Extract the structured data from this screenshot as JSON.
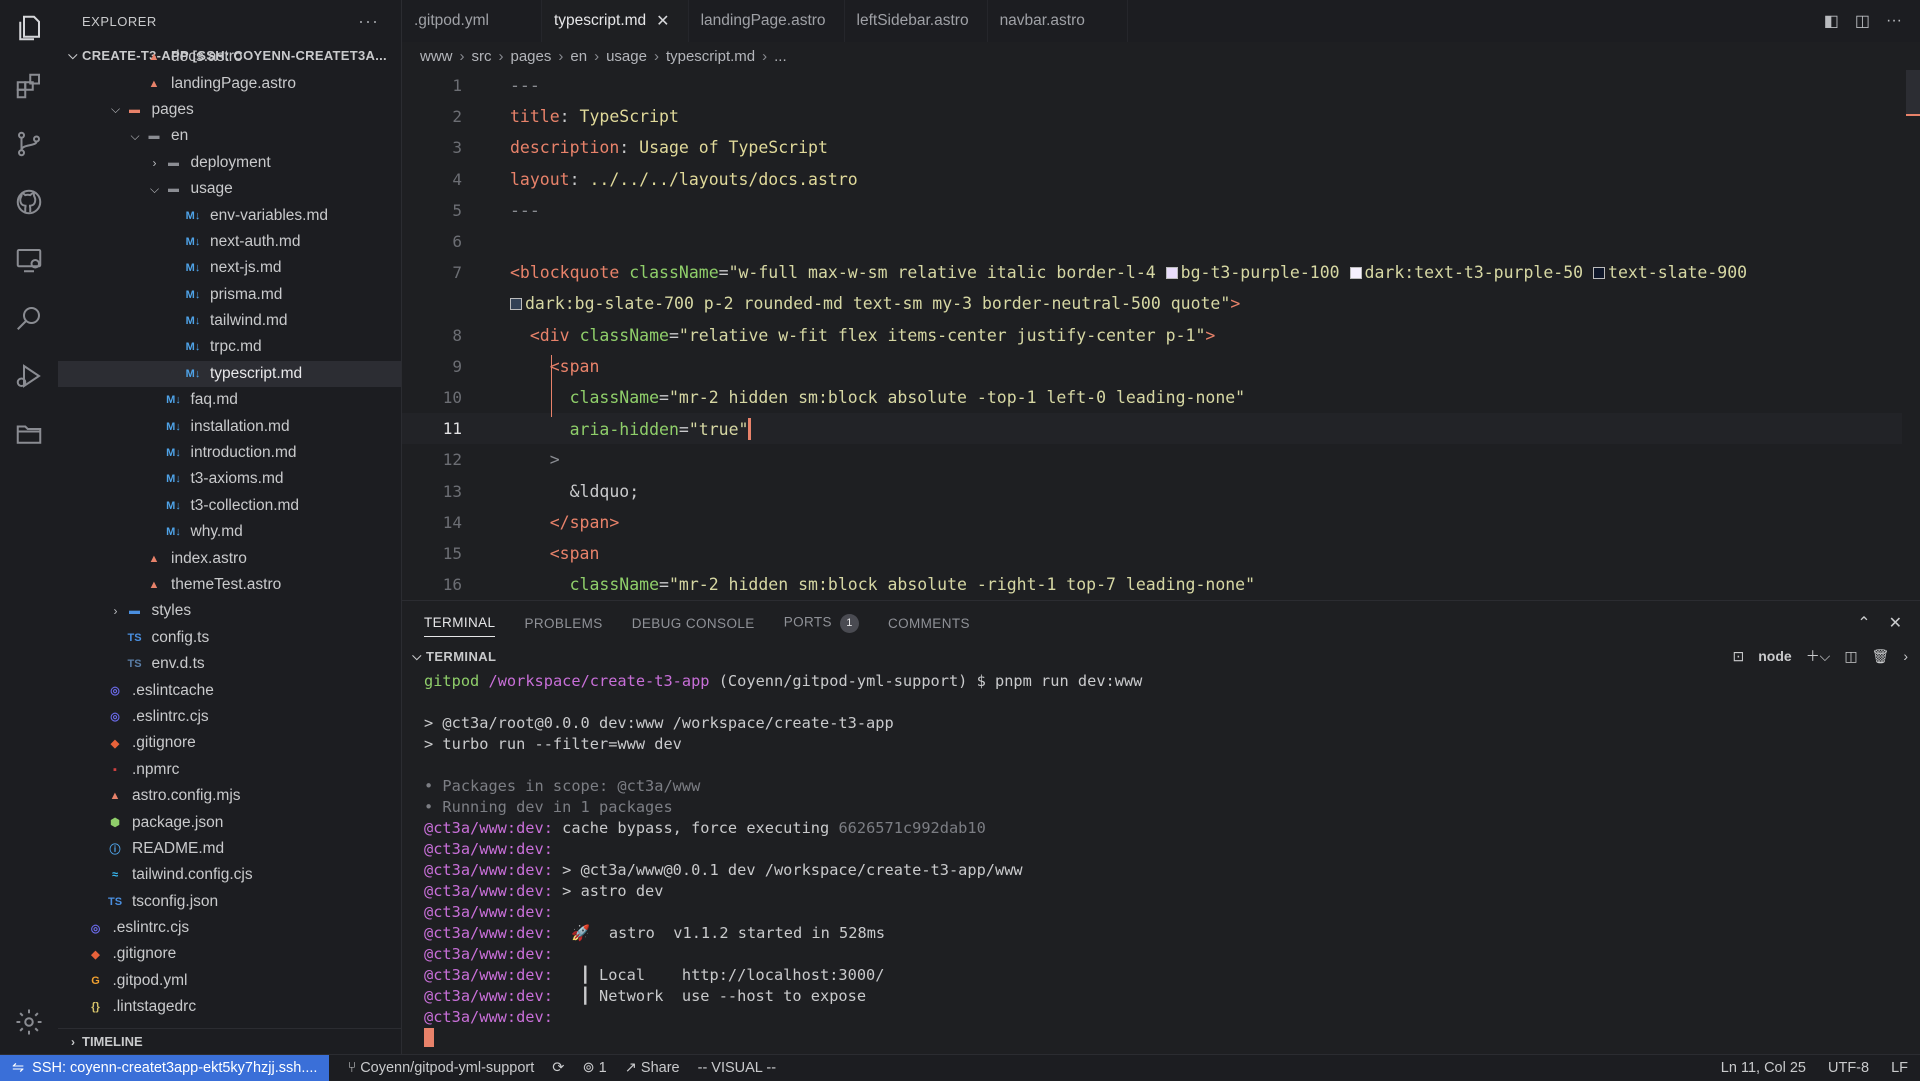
{
  "explorer": {
    "title": "EXPLORER",
    "more": "···",
    "root": "CREATE-T3-APP [SSH: COYENN-CREATET3A...",
    "timeline": "TIMELINE",
    "tree": [
      {
        "label": "docs.astro",
        "indent": 4,
        "icon": "astro"
      },
      {
        "label": "landingPage.astro",
        "indent": 4,
        "icon": "astro"
      },
      {
        "label": "pages",
        "indent": 3,
        "icon": "folder-red",
        "chev": "v"
      },
      {
        "label": "en",
        "indent": 4,
        "icon": "folder",
        "chev": "v"
      },
      {
        "label": "deployment",
        "indent": 5,
        "icon": "folder",
        "chev": ">"
      },
      {
        "label": "usage",
        "indent": 5,
        "icon": "folder",
        "chev": "v"
      },
      {
        "label": "env-variables.md",
        "indent": 6,
        "icon": "md"
      },
      {
        "label": "next-auth.md",
        "indent": 6,
        "icon": "md"
      },
      {
        "label": "next-js.md",
        "indent": 6,
        "icon": "md"
      },
      {
        "label": "prisma.md",
        "indent": 6,
        "icon": "md"
      },
      {
        "label": "tailwind.md",
        "indent": 6,
        "icon": "md"
      },
      {
        "label": "trpc.md",
        "indent": 6,
        "icon": "md"
      },
      {
        "label": "typescript.md",
        "indent": 6,
        "icon": "md",
        "selected": true
      },
      {
        "label": "faq.md",
        "indent": 5,
        "icon": "md"
      },
      {
        "label": "installation.md",
        "indent": 5,
        "icon": "md"
      },
      {
        "label": "introduction.md",
        "indent": 5,
        "icon": "md"
      },
      {
        "label": "t3-axioms.md",
        "indent": 5,
        "icon": "md"
      },
      {
        "label": "t3-collection.md",
        "indent": 5,
        "icon": "md"
      },
      {
        "label": "why.md",
        "indent": 5,
        "icon": "md"
      },
      {
        "label": "index.astro",
        "indent": 4,
        "icon": "astro"
      },
      {
        "label": "themeTest.astro",
        "indent": 4,
        "icon": "astro"
      },
      {
        "label": "styles",
        "indent": 3,
        "icon": "folder-blue",
        "chev": ">"
      },
      {
        "label": "config.ts",
        "indent": 3,
        "icon": "ts"
      },
      {
        "label": "env.d.ts",
        "indent": 3,
        "icon": "dts"
      },
      {
        "label": ".eslintcache",
        "indent": 2,
        "icon": "eslint"
      },
      {
        "label": ".eslintrc.cjs",
        "indent": 2,
        "icon": "eslint"
      },
      {
        "label": ".gitignore",
        "indent": 2,
        "icon": "git"
      },
      {
        "label": ".npmrc",
        "indent": 2,
        "icon": "npm"
      },
      {
        "label": "astro.config.mjs",
        "indent": 2,
        "icon": "astro"
      },
      {
        "label": "package.json",
        "indent": 2,
        "icon": "pkg"
      },
      {
        "label": "README.md",
        "indent": 2,
        "icon": "info"
      },
      {
        "label": "tailwind.config.cjs",
        "indent": 2,
        "icon": "tailwind"
      },
      {
        "label": "tsconfig.json",
        "indent": 2,
        "icon": "tsconfig"
      },
      {
        "label": ".eslintrc.cjs",
        "indent": 1,
        "icon": "eslint"
      },
      {
        "label": ".gitignore",
        "indent": 1,
        "icon": "git"
      },
      {
        "label": ".gitpod.yml",
        "indent": 1,
        "icon": "gitpod"
      },
      {
        "label": ".lintstagedrc",
        "indent": 1,
        "icon": "json"
      }
    ]
  },
  "tabs": [
    {
      "label": ".gitpod.yml",
      "active": false
    },
    {
      "label": "typescript.md",
      "active": true
    },
    {
      "label": "landingPage.astro",
      "active": false
    },
    {
      "label": "leftSidebar.astro",
      "active": false
    },
    {
      "label": "navbar.astro",
      "active": false
    }
  ],
  "breadcrumbs": [
    "www",
    "src",
    "pages",
    "en",
    "usage",
    "typescript.md",
    "..."
  ],
  "editor": {
    "current_line": 11,
    "lines": [
      {
        "n": "1",
        "html": "<span class=\"g\">---</span>"
      },
      {
        "n": "2",
        "html": "<span class=\"k\">title</span>: <span class=\"v\">TypeScript</span>"
      },
      {
        "n": "3",
        "html": "<span class=\"k\">description</span>: <span class=\"v\">Usage of TypeScript</span>"
      },
      {
        "n": "4",
        "html": "<span class=\"k\">layout</span>: <span class=\"v\">../../../layouts/docs.astro</span>"
      },
      {
        "n": "5",
        "html": "<span class=\"g\">---</span>"
      },
      {
        "n": "6",
        "html": ""
      },
      {
        "n": "7",
        "html": "<span class=\"k\">&lt;blockquote</span> <span class=\"a\">className</span>=<span class=\"s\">\"w-full max-w-sm relative italic border-l-4 <i class=sw style=background:#e9ddfb></i>bg-t3-purple-100 <i class=sw style=background:#f5f0fe></i>dark:text-t3-purple-50 <i class=sw style=background:#0f172a></i>text-slate-900</span>"
      },
      {
        "n": "",
        "html": "<span class=\"s\"><i class=sw style=background:#334155></i>dark:bg-slate-700 p-2 rounded-md text-sm my-3 border-neutral-500 quote\"</span><span class=\"k\">&gt;</span>"
      },
      {
        "n": "8",
        "html": "  <span class=\"k\">&lt;div</span> <span class=\"a\">className</span>=<span class=\"s\">\"relative w-fit flex items-center justify-center p-1\"</span><span class=\"k\">&gt;</span>"
      },
      {
        "n": "9",
        "html": "    <span class=\"k\">&lt;span</span>"
      },
      {
        "n": "10",
        "html": "      <span class=\"a\">className</span>=<span class=\"s\">\"mr-2 hidden sm:block absolute -top-1 left-0 leading-none\"</span>"
      },
      {
        "n": "11",
        "html": "      <span class=\"a\">aria-hidden</span>=<span class=\"s\">\"true\"</span><i class=\"cursor\"></i>"
      },
      {
        "n": "12",
        "html": "    <span class=\"g\">&gt;</span>"
      },
      {
        "n": "13",
        "html": "      &amp;ldquo;"
      },
      {
        "n": "14",
        "html": "    <span class=\"k\">&lt;/span&gt;</span>"
      },
      {
        "n": "15",
        "html": "    <span class=\"k\">&lt;span</span>"
      },
      {
        "n": "16",
        "html": "      <span class=\"a\">className</span>=<span class=\"s\">\"mr-2 hidden sm:block absolute -right-1 top-7 leading-none\"</span>"
      }
    ]
  },
  "panel": {
    "tabs": [
      "TERMINAL",
      "PROBLEMS",
      "DEBUG CONSOLE",
      "PORTS",
      "COMMENTS"
    ],
    "ports_badge": "1",
    "terminal_title": "TERMINAL",
    "shell_name": "node",
    "lines": [
      {
        "html": "<span class=\"tg\">gitpod</span> <span class=\"tp\">/workspace/create-t3-app</span> (Coyenn/gitpod-yml-support) $ pnpm run dev:www"
      },
      {
        "html": ""
      },
      {
        "html": "&gt; @ct3a/root@0.0.0 dev:www /workspace/create-t3-app"
      },
      {
        "html": "&gt; turbo run --filter=www dev"
      },
      {
        "html": ""
      },
      {
        "html": "<span class=\"td\">• Packages in scope: @ct3a/www</span>"
      },
      {
        "html": "<span class=\"td\">• Running dev in 1 packages</span>"
      },
      {
        "html": "<span class=\"tp\">@ct3a/www:dev:</span> cache bypass, force executing <span class=\"td\">6626571c992dab10</span>"
      },
      {
        "html": "<span class=\"tp\">@ct3a/www:dev:</span>"
      },
      {
        "html": "<span class=\"tp\">@ct3a/www:dev:</span> &gt; @ct3a/www@0.0.1 dev /workspace/create-t3-app/www"
      },
      {
        "html": "<span class=\"tp\">@ct3a/www:dev:</span> &gt; astro dev"
      },
      {
        "html": "<span class=\"tp\">@ct3a/www:dev:</span>"
      },
      {
        "html": "<span class=\"tp\">@ct3a/www:dev:</span>  🚀  astro  v1.1.2 started in 528ms"
      },
      {
        "html": "<span class=\"tp\">@ct3a/www:dev:</span>"
      },
      {
        "html": "<span class=\"tp\">@ct3a/www:dev:</span>   ┃ Local    http://localhost:3000/"
      },
      {
        "html": "<span class=\"tp\">@ct3a/www:dev:</span>   ┃ Network  use --host to expose"
      },
      {
        "html": "<span class=\"tp\">@ct3a/www:dev:</span>"
      },
      {
        "html": "<i class=\"tcur\"></i>"
      }
    ]
  },
  "status": {
    "remote": "SSH: coyenn-createt3app-ekt5ky7hzjj.ssh....",
    "branch": "Coyenn/gitpod-yml-support",
    "sync": "⟳",
    "ports": "1",
    "share": "Share",
    "mode": "-- VISUAL --",
    "position": "Ln 11, Col 25",
    "encoding": "UTF-8",
    "eol": "LF"
  },
  "colors": {
    "accent": "#e8826a",
    "remote_bg": "#3a6fd8",
    "string": "#d6d7a3",
    "attr": "#8fce6a"
  }
}
